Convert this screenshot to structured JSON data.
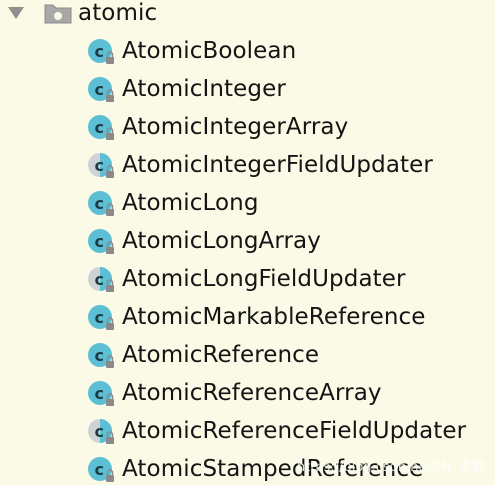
{
  "tree": {
    "package": {
      "name": "atomic",
      "expanded": true
    },
    "classes": [
      {
        "label": "AtomicBoolean",
        "kind": "class"
      },
      {
        "label": "AtomicInteger",
        "kind": "class"
      },
      {
        "label": "AtomicIntegerArray",
        "kind": "class"
      },
      {
        "label": "AtomicIntegerFieldUpdater",
        "kind": "abstract-class"
      },
      {
        "label": "AtomicLong",
        "kind": "class"
      },
      {
        "label": "AtomicLongArray",
        "kind": "class"
      },
      {
        "label": "AtomicLongFieldUpdater",
        "kind": "abstract-class"
      },
      {
        "label": "AtomicMarkableReference",
        "kind": "class"
      },
      {
        "label": "AtomicReference",
        "kind": "class"
      },
      {
        "label": "AtomicReferenceArray",
        "kind": "class"
      },
      {
        "label": "AtomicReferenceFieldUpdater",
        "kind": "abstract-class"
      },
      {
        "label": "AtomicStampedReference",
        "kind": "class"
      }
    ]
  },
  "watermark": "https://blog.csdn.net/Mr_朱鹏",
  "colors": {
    "background": "#fafae6",
    "class_icon": "#5cbfd3",
    "abstract_icon_bg": "#cfd3d6",
    "lock_icon": "#8a8a8a",
    "text": "#141414"
  },
  "icons": {
    "toggle": "triangle-down-icon",
    "package": "package-folder-icon",
    "class": "class-icon",
    "abstract_class": "abstract-class-icon",
    "lock": "lock-icon"
  }
}
